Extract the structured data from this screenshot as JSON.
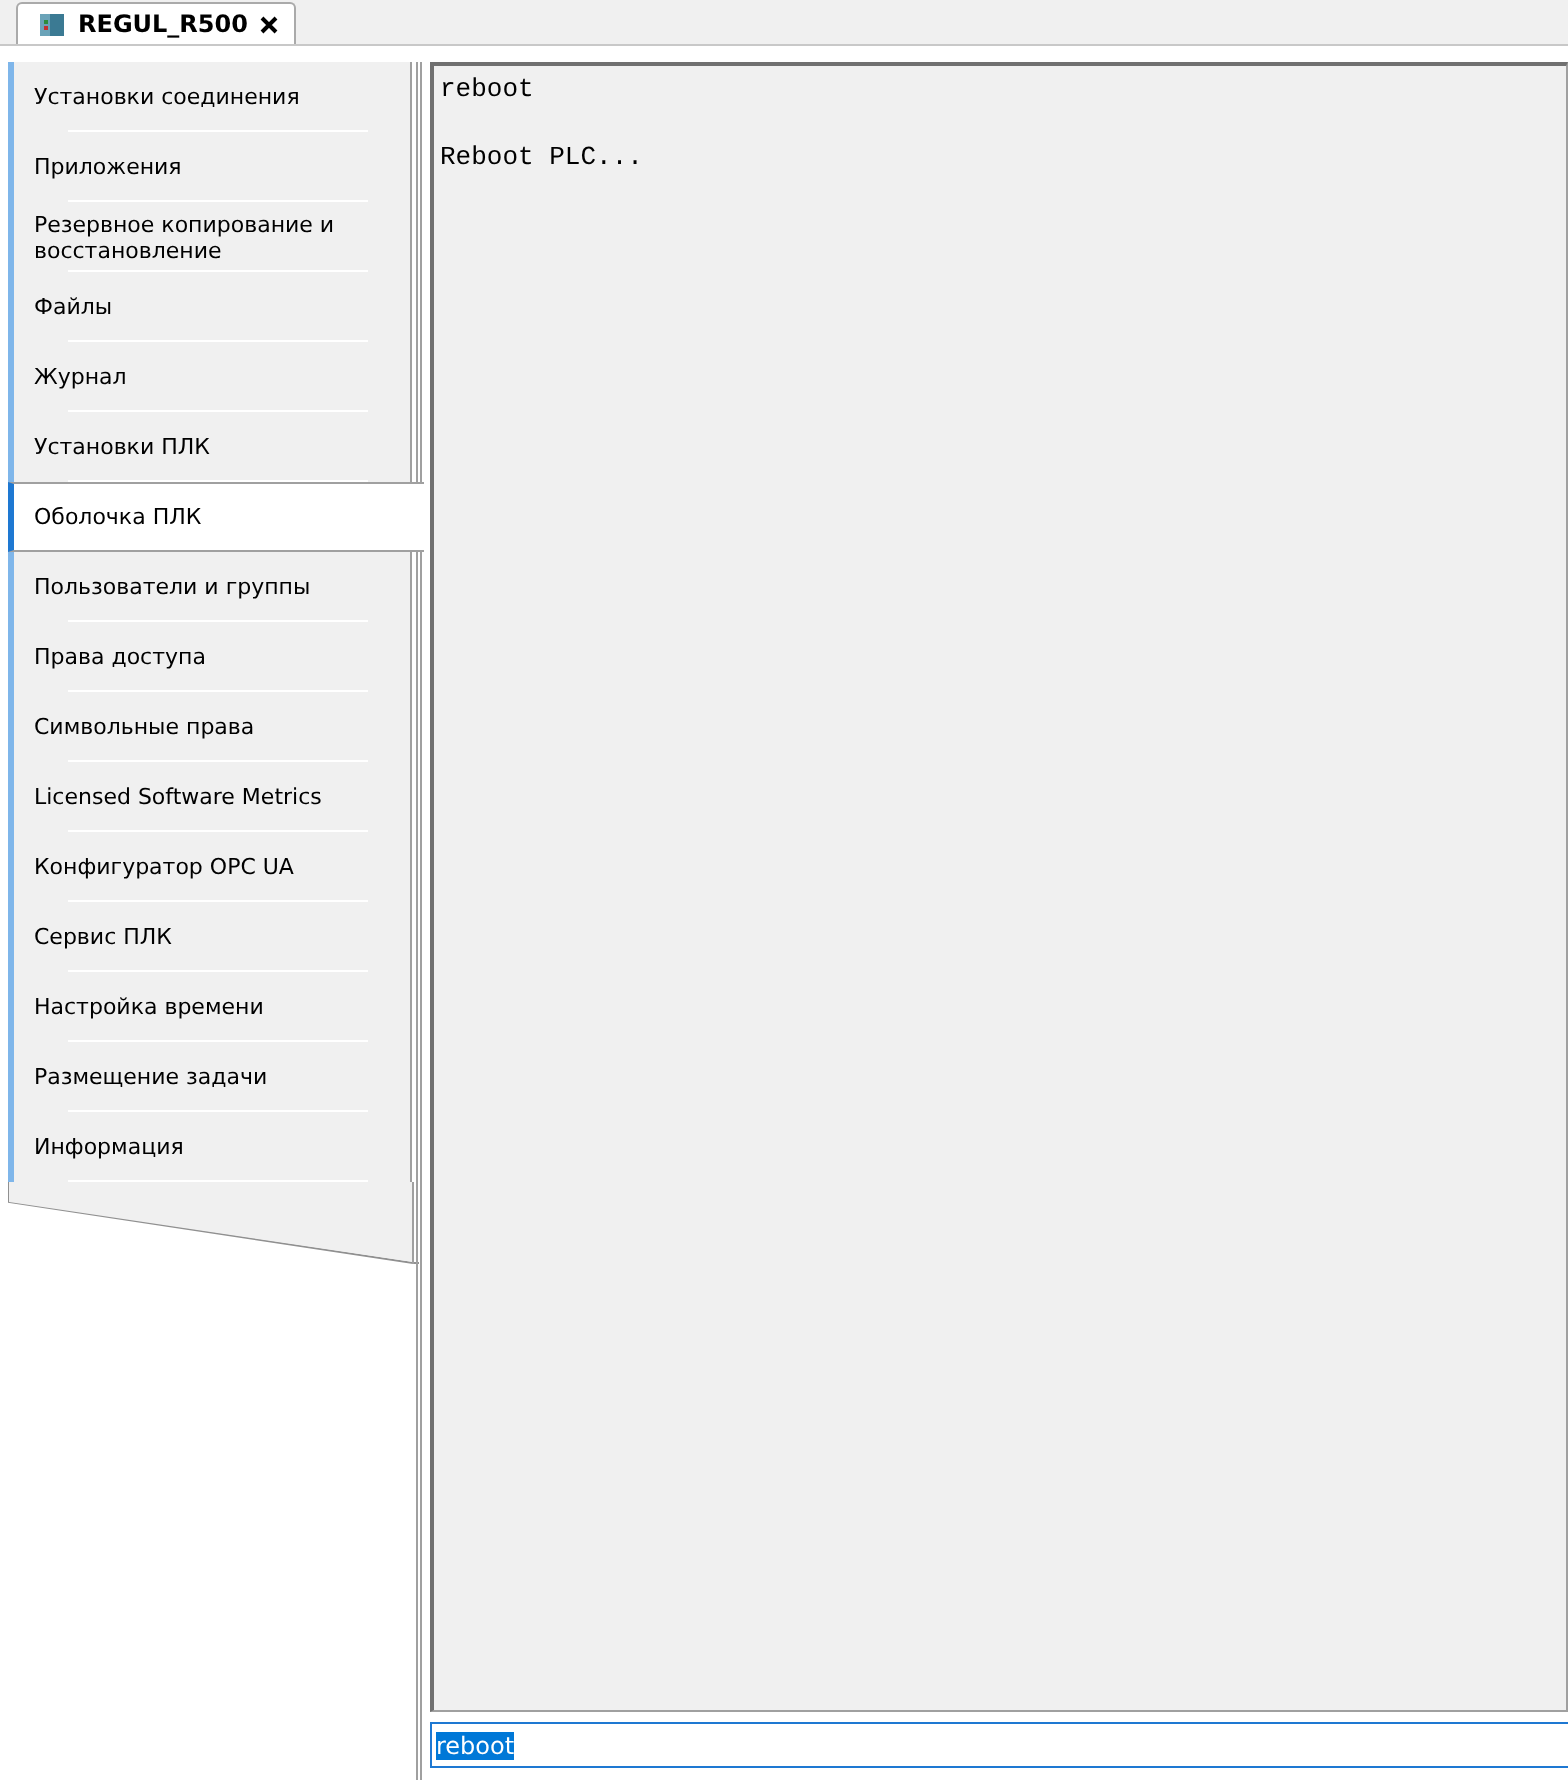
{
  "tab": {
    "title": "REGUL_R500",
    "selected": true
  },
  "sidebar": {
    "items": [
      {
        "label": "Установки соединения",
        "selected": false
      },
      {
        "label": "Приложения",
        "selected": false
      },
      {
        "label": "Резервное копирование и восстановление",
        "selected": false
      },
      {
        "label": "Файлы",
        "selected": false
      },
      {
        "label": "Журнал",
        "selected": false
      },
      {
        "label": "Установки ПЛК",
        "selected": false
      },
      {
        "label": "Оболочка ПЛК",
        "selected": true
      },
      {
        "label": "Пользователи и группы",
        "selected": false
      },
      {
        "label": "Права доступа",
        "selected": false
      },
      {
        "label": "Символьные права",
        "selected": false
      },
      {
        "label": "Licensed Software Metrics",
        "selected": false
      },
      {
        "label": "Конфигуратор OPC UA",
        "selected": false
      },
      {
        "label": "Сервис ПЛК",
        "selected": false
      },
      {
        "label": "Настройка времени",
        "selected": false
      },
      {
        "label": "Размещение задачи",
        "selected": false
      },
      {
        "label": "Информация",
        "selected": false
      }
    ]
  },
  "console": {
    "output": [
      {
        "text": "reboot",
        "kind": "command"
      },
      {
        "text": "Reboot PLC...",
        "kind": "response"
      }
    ]
  },
  "command_input": {
    "value": "reboot",
    "text_selected": true
  }
}
